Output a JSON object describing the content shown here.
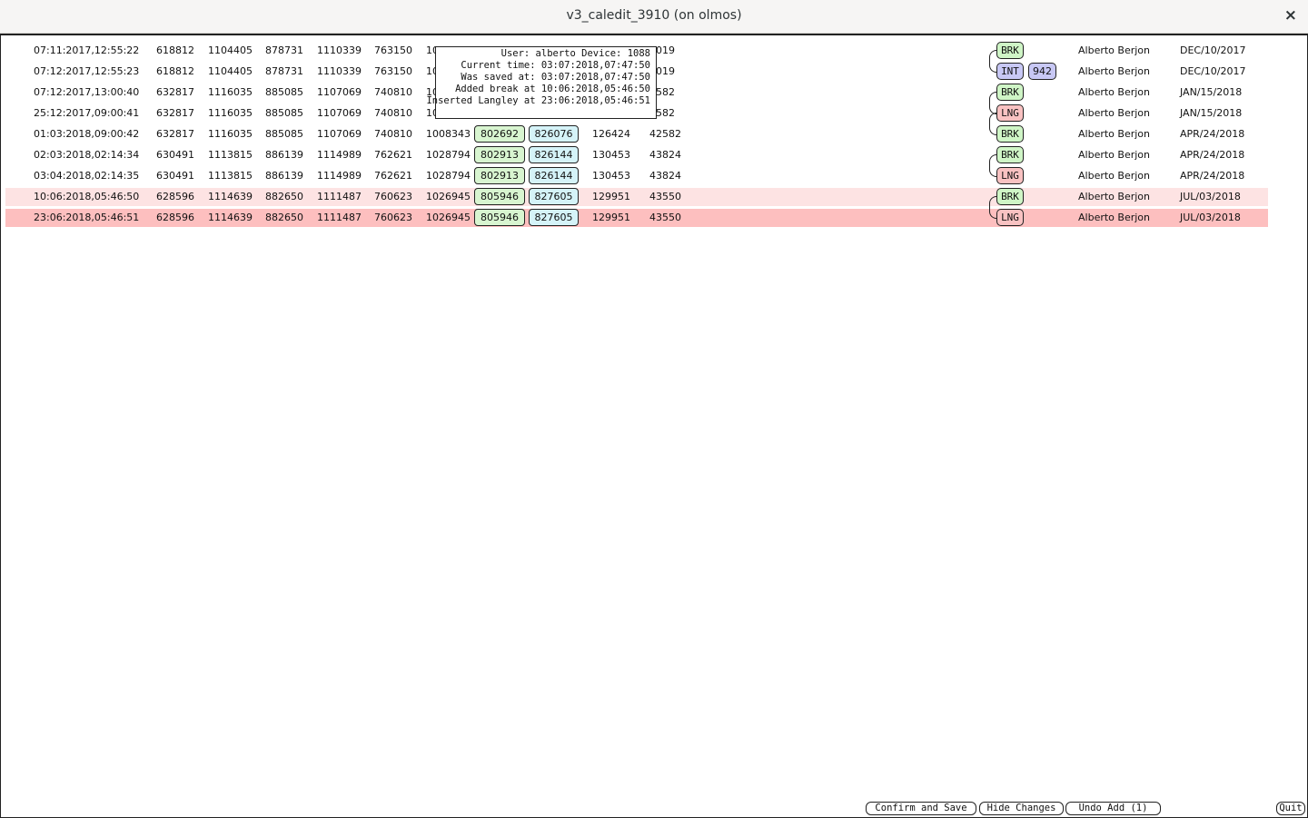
{
  "window": {
    "title": "v3_caledit_3910 (on olmos)",
    "close_glyph": "×"
  },
  "rows": [
    {
      "time": "07:11:2017,12:55:22",
      "c1": "618812",
      "c2": "1104405",
      "c3": "878731",
      "c4": "1110339",
      "c5": "763150",
      "c6": "10",
      "g": "",
      "cy": "",
      "c7": "",
      "c8": "4019",
      "tag": "BRK",
      "extra": "",
      "user": "Alberto Berjon",
      "date": "DEC/10/2017",
      "hl": ""
    },
    {
      "time": "07:12:2017,12:55:23",
      "c1": "618812",
      "c2": "1104405",
      "c3": "878731",
      "c4": "1110339",
      "c5": "763150",
      "c6": "10",
      "g": "",
      "cy": "",
      "c7": "",
      "c8": "4019",
      "tag": "INT",
      "extra": "942",
      "user": "Alberto Berjon",
      "date": "DEC/10/2017",
      "hl": ""
    },
    {
      "time": "07:12:2017,13:00:40",
      "c1": "632817",
      "c2": "1116035",
      "c3": "885085",
      "c4": "1107069",
      "c5": "740810",
      "c6": "10",
      "g": "",
      "cy": "",
      "c7": "",
      "c8": "2582",
      "tag": "BRK",
      "extra": "",
      "user": "Alberto Berjon",
      "date": "JAN/15/2018",
      "hl": ""
    },
    {
      "time": "25:12:2017,09:00:41",
      "c1": "632817",
      "c2": "1116035",
      "c3": "885085",
      "c4": "1107069",
      "c5": "740810",
      "c6": "10",
      "g": "",
      "cy": "",
      "c7": "",
      "c8": "2582",
      "tag": "LNG",
      "extra": "",
      "user": "Alberto Berjon",
      "date": "JAN/15/2018",
      "hl": ""
    },
    {
      "time": "01:03:2018,09:00:42",
      "c1": "632817",
      "c2": "1116035",
      "c3": "885085",
      "c4": "1107069",
      "c5": "740810",
      "c6": "1008343",
      "g": "802692",
      "cy": "826076",
      "c7": "126424",
      "c8": "42582",
      "tag": "BRK",
      "extra": "",
      "user": "Alberto Berjon",
      "date": "APR/24/2018",
      "hl": ""
    },
    {
      "time": "02:03:2018,02:14:34",
      "c1": "630491",
      "c2": "1113815",
      "c3": "886139",
      "c4": "1114989",
      "c5": "762621",
      "c6": "1028794",
      "g": "802913",
      "cy": "826144",
      "c7": "130453",
      "c8": "43824",
      "tag": "BRK",
      "extra": "",
      "user": "Alberto Berjon",
      "date": "APR/24/2018",
      "hl": ""
    },
    {
      "time": "03:04:2018,02:14:35",
      "c1": "630491",
      "c2": "1113815",
      "c3": "886139",
      "c4": "1114989",
      "c5": "762621",
      "c6": "1028794",
      "g": "802913",
      "cy": "826144",
      "c7": "130453",
      "c8": "43824",
      "tag": "LNG",
      "extra": "",
      "user": "Alberto Berjon",
      "date": "APR/24/2018",
      "hl": ""
    },
    {
      "time": "10:06:2018,05:46:50",
      "c1": "628596",
      "c2": "1114639",
      "c3": "882650",
      "c4": "1111487",
      "c5": "760623",
      "c6": "1026945",
      "g": "805946",
      "cy": "827605",
      "c7": "129951",
      "c8": "43550",
      "tag": "BRK",
      "extra": "",
      "user": "Alberto Berjon",
      "date": "JUL/03/2018",
      "hl": "light"
    },
    {
      "time": "23:06:2018,05:46:51",
      "c1": "628596",
      "c2": "1114639",
      "c3": "882650",
      "c4": "1111487",
      "c5": "760623",
      "c6": "1026945",
      "g": "805946",
      "cy": "827605",
      "c7": "129951",
      "c8": "43550",
      "tag": "LNG",
      "extra": "",
      "user": "Alberto Berjon",
      "date": "JUL/03/2018",
      "hl": "strong"
    }
  ],
  "tooltip": {
    "line1": "User: alberto Device: 1088",
    "line2": "Current time: 03:07:2018,07:47:50",
    "line3": "Was saved at: 03:07:2018,07:47:50",
    "line4": "Added break at 10:06:2018,05:46:50",
    "line5": "Inserted Langley at 23:06:2018,05:46:51"
  },
  "buttons": {
    "confirm_save": "Confirm and Save",
    "hide_changes": "Hide Changes",
    "undo_add": "Undo Add (1)",
    "quit": "Quit"
  },
  "colors": {
    "brk": "#cff5c6",
    "lng": "#f9c2c2",
    "int": "#c8c8f5",
    "row_highlight_light": "#fde3e3",
    "row_highlight_strong": "#fdbfbf"
  }
}
